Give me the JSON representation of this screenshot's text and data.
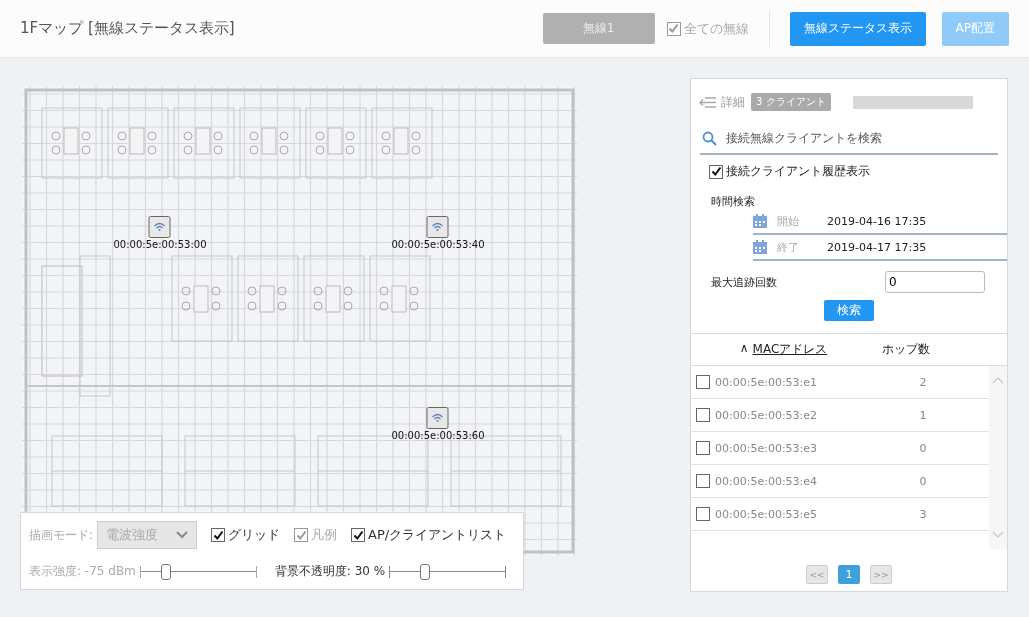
{
  "header": {
    "title": "1Fマップ [無線ステータス表示]",
    "radio_button": {
      "label": "無線1",
      "disabled": true
    },
    "all_radios": {
      "label": "全ての無線",
      "checked": true,
      "disabled": true
    },
    "buttons": [
      {
        "label": "無線ステータス表示",
        "disabled": false
      },
      {
        "label": "AP配置",
        "disabled": true
      }
    ]
  },
  "map": {
    "access_points": [
      {
        "label": "00:00:5e:00:53:00"
      },
      {
        "label": "00:00:5e:00:53:40"
      },
      {
        "label": "00:00:5e:00:53:60"
      }
    ],
    "controls": {
      "mode_label": "描画モード:",
      "mode_value": "電波強度",
      "mode_disabled": true,
      "checkboxes": [
        {
          "label": "グリッド",
          "checked": true,
          "disabled": false
        },
        {
          "label": "凡例",
          "checked": true,
          "disabled": true
        },
        {
          "label": "AP/クライアントリスト",
          "checked": true,
          "disabled": false
        }
      ],
      "sliders": [
        {
          "label": "表示強度: -75 dBm",
          "level": 0.22,
          "disabled": true
        },
        {
          "label": "背景不透明度: 30 %",
          "level": 0.3,
          "disabled": false
        }
      ]
    }
  },
  "panel": {
    "back_label": "詳細",
    "badge": "3 クライアント",
    "search": {
      "placeholder": "接続無線クライアントを検索"
    },
    "history": {
      "label": "接続クライアント履歴表示",
      "checked": true
    },
    "time_search": "時間検索",
    "start": {
      "label": "開始",
      "value": "2019-04-16 17:35"
    },
    "end": {
      "label": "終了",
      "value": "2019-04-17 17:35"
    },
    "max_trace": {
      "label": "最大追跡回数",
      "value": "0"
    },
    "search_button": "検索",
    "table": {
      "sort_mark": "∧",
      "columns": [
        "MACアドレス",
        "ホップ数"
      ],
      "rows": [
        {
          "mac": "00:00:5e:00:53:e1",
          "hops": "2",
          "checked": false
        },
        {
          "mac": "00:00:5e:00:53:e2",
          "hops": "1",
          "checked": false
        },
        {
          "mac": "00:00:5e:00:53:e3",
          "hops": "0",
          "checked": false
        },
        {
          "mac": "00:00:5e:00:53:e4",
          "hops": "0",
          "checked": false
        },
        {
          "mac": "00:00:5e:00:53:e5",
          "hops": "3",
          "checked": false
        }
      ]
    },
    "pagination": {
      "prev": "<<",
      "pages": [
        {
          "label": "1",
          "selected": true
        }
      ],
      "next": ">>"
    }
  }
}
